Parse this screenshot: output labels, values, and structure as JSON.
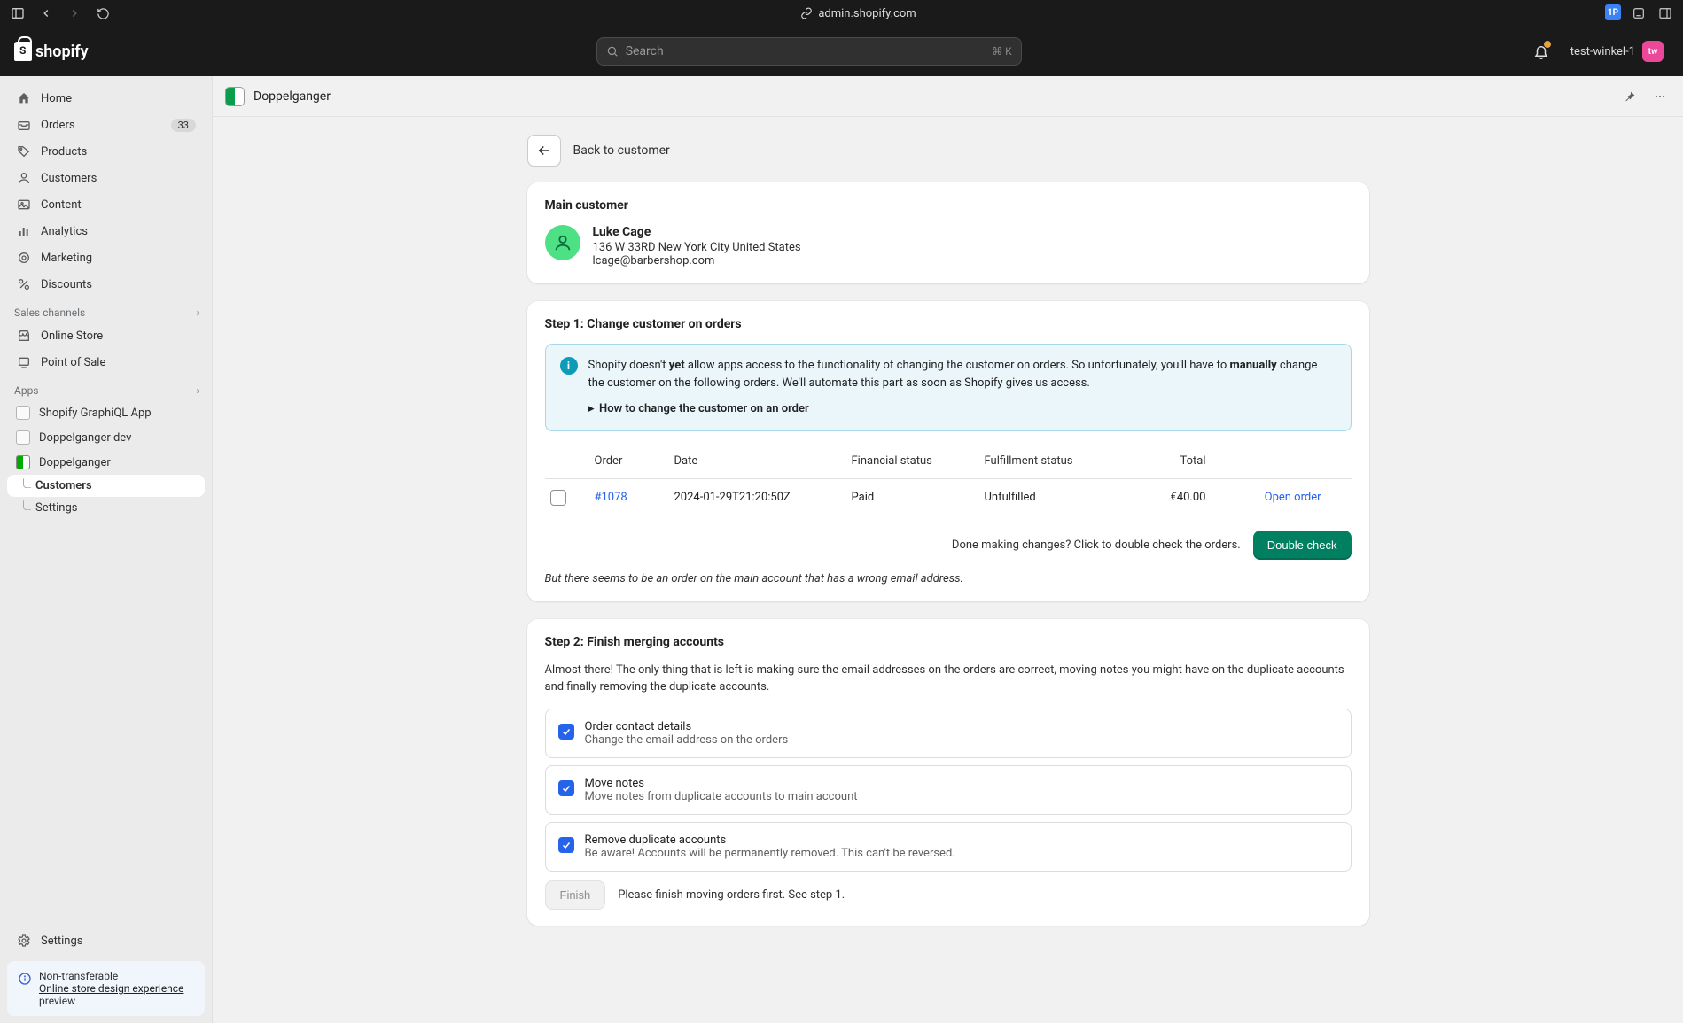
{
  "browser": {
    "url_host": "admin.shopify.com"
  },
  "topbar": {
    "brand": "shopify",
    "search_placeholder": "Search",
    "search_kbd": "⌘ K",
    "store_name": "test-winkel-1",
    "avatar_initials": "tw"
  },
  "sidebar": {
    "primary": [
      {
        "label": "Home"
      },
      {
        "label": "Orders",
        "badge": "33"
      },
      {
        "label": "Products"
      },
      {
        "label": "Customers"
      },
      {
        "label": "Content"
      },
      {
        "label": "Analytics"
      },
      {
        "label": "Marketing"
      },
      {
        "label": "Discounts"
      }
    ],
    "channels_header": "Sales channels",
    "channels": [
      {
        "label": "Online Store"
      },
      {
        "label": "Point of Sale"
      }
    ],
    "apps_header": "Apps",
    "apps": [
      {
        "label": "Shopify GraphiQL App"
      },
      {
        "label": "Doppelganger dev"
      },
      {
        "label": "Doppelganger"
      }
    ],
    "app_sub": [
      {
        "label": "Customers",
        "active": true
      },
      {
        "label": "Settings"
      }
    ],
    "settings_label": "Settings",
    "notice_line1": "Non-transferable",
    "notice_link": "Online store design experience",
    "notice_after": " preview"
  },
  "apphead": {
    "title": "Doppelganger"
  },
  "page": {
    "back_label": "Back to customer",
    "main_customer": {
      "heading": "Main customer",
      "name": "Luke Cage",
      "address": "136 W 33RD New York City United States",
      "email": "lcage@barbershop.com"
    },
    "step1": {
      "heading": "Step 1: Change customer on orders",
      "info_pre": "Shopify doesn't ",
      "info_bold1": "yet",
      "info_mid": " allow apps access to the functionality of changing the customer on orders. So unfortunately, you'll have to ",
      "info_bold2": "manually",
      "info_post": " change the customer on the following orders. We'll automate this part as soon as Shopify gives us access.",
      "how_link": "How to change the customer on an order",
      "table": {
        "headers": {
          "order": "Order",
          "date": "Date",
          "fin": "Financial status",
          "ful": "Fulfillment status",
          "total": "Total"
        },
        "rows": [
          {
            "order": "#1078",
            "date": "2024-01-29T21:20:50Z",
            "fin": "Paid",
            "ful": "Unfulfilled",
            "total": "€40.00",
            "action": "Open order"
          }
        ]
      },
      "done_text": "Done making changes? Click to double check the orders.",
      "double_check_btn": "Double check",
      "italic_note": "But there seems to be an order on the main account that has a wrong email address."
    },
    "step2": {
      "heading": "Step 2: Finish merging accounts",
      "desc": "Almost there! The only thing that is left is making sure the email addresses on the orders are correct, moving notes you might have on the duplicate accounts and finally removing the duplicate accounts.",
      "options": [
        {
          "title": "Order contact details",
          "desc": "Change the email address on the orders"
        },
        {
          "title": "Move notes",
          "desc": "Move notes from duplicate accounts to main account"
        },
        {
          "title": "Remove duplicate accounts",
          "desc": "Be aware! Accounts will be permanently removed. This can't be reversed."
        }
      ],
      "finish_btn": "Finish",
      "finish_hint": "Please finish moving orders first. See step 1."
    }
  }
}
